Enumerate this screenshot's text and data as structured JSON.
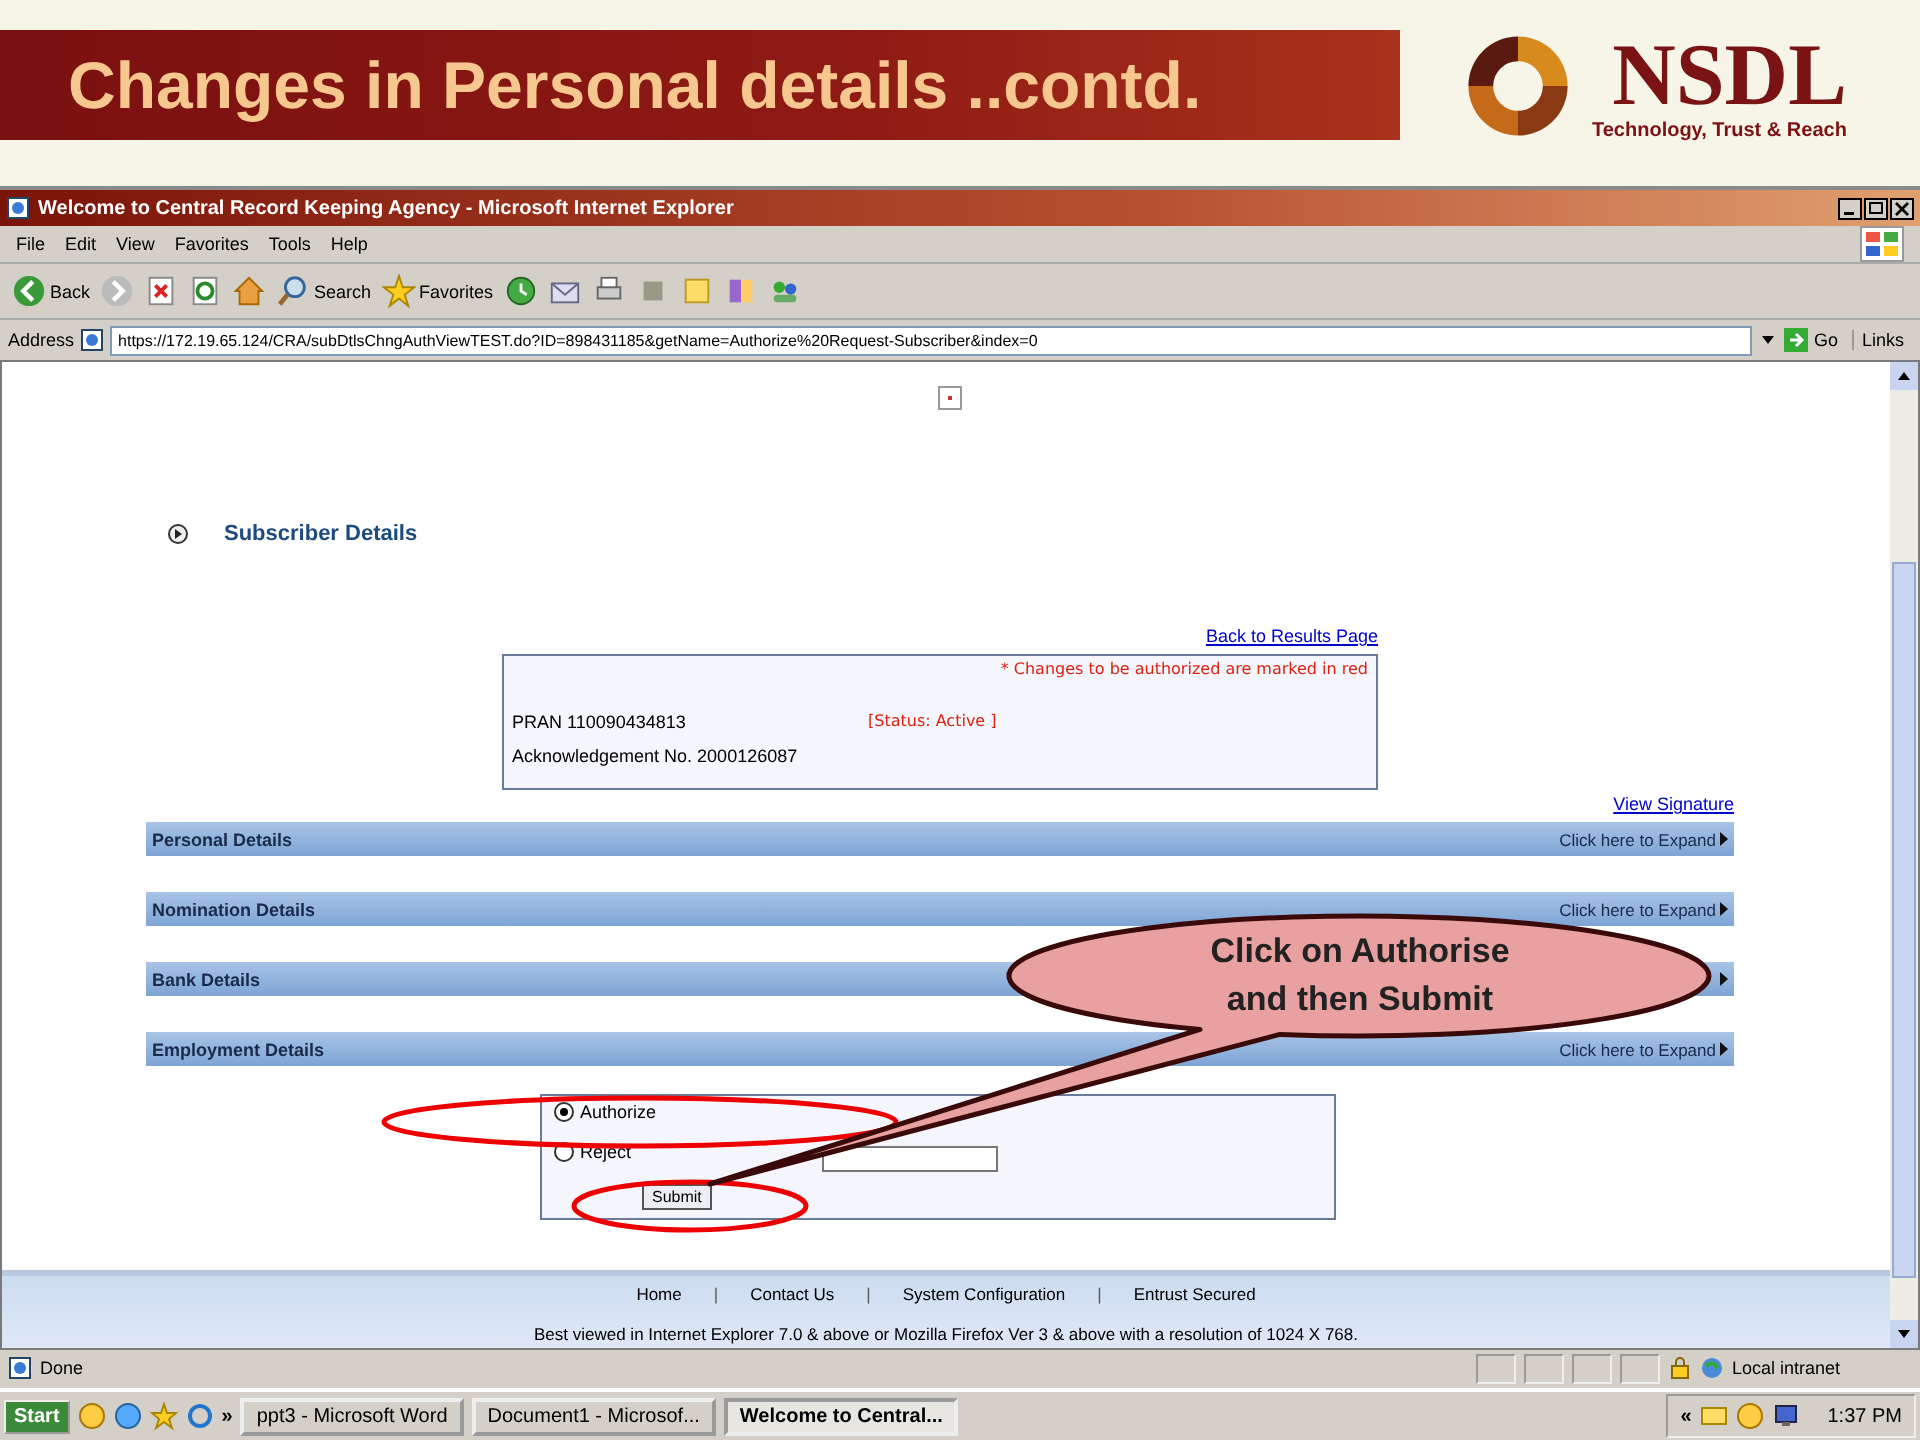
{
  "slide": {
    "title": "Changes in Personal details ..contd.",
    "logo": {
      "name": "NSDL",
      "tagline": "Technology, Trust & Reach"
    }
  },
  "browser": {
    "title": "Welcome to Central Record Keeping Agency - Microsoft Internet Explorer",
    "menu": [
      "File",
      "Edit",
      "View",
      "Favorites",
      "Tools",
      "Help"
    ],
    "toolbar": {
      "back": "Back",
      "search": "Search",
      "favorites": "Favorites"
    },
    "address": {
      "label": "Address",
      "url": "https://172.19.65.124/CRA/subDtlsChngAuthViewTEST.do?ID=898431185&getName=Authorize%20Request-Subscriber&index=0",
      "go": "Go",
      "links": "Links"
    }
  },
  "page": {
    "heading": "Subscriber Details",
    "back_link": "Back to Results Page",
    "note": "* Changes to be authorized are marked in red",
    "pran": "PRAN  110090434813",
    "status": "[Status: Active ]",
    "ack": "Acknowledgement No. 2000126087",
    "view_signature": "View Signature",
    "sections": [
      {
        "title": "Personal Details",
        "expand": "Click here to Expand"
      },
      {
        "title": "Nomination Details",
        "expand": "Click here to Expand"
      },
      {
        "title": "Bank Details"
      },
      {
        "title": "Employment Details",
        "expand": "Click here to Expand"
      }
    ],
    "options": [
      {
        "label": "Authorize",
        "selected": true
      },
      {
        "label": "Reject",
        "selected": false
      }
    ],
    "submit": "Submit",
    "footer_links": [
      {
        "kind": "link",
        "text": "Home"
      },
      {
        "kind": "separator",
        "text": "|"
      },
      {
        "kind": "link",
        "text": "Contact Us"
      },
      {
        "kind": "separator",
        "text": "|"
      },
      {
        "kind": "link",
        "text": "System Configuration"
      },
      {
        "kind": "separator",
        "text": "|"
      },
      {
        "kind": "link",
        "text": "Entrust Secured"
      }
    ],
    "footer_note": "Best viewed in Internet Explorer 7.0 & above or Mozilla Firefox Ver 3 & above with a resolution of 1024 X 768."
  },
  "status_bar": {
    "text": "Done",
    "zone": "Local intranet"
  },
  "taskbar": {
    "start": "Start",
    "more": "»",
    "tasks": [
      {
        "label": "ppt3 - Microsoft Word",
        "selected": false
      },
      {
        "label": "Document1 - Microsof...",
        "selected": false
      },
      {
        "label": "Welcome to Central...",
        "selected": true
      }
    ],
    "tray_more": "«",
    "clock": "1:37 PM"
  },
  "callout": {
    "lines": [
      "Click on Authorise",
      "and then Submit"
    ]
  }
}
